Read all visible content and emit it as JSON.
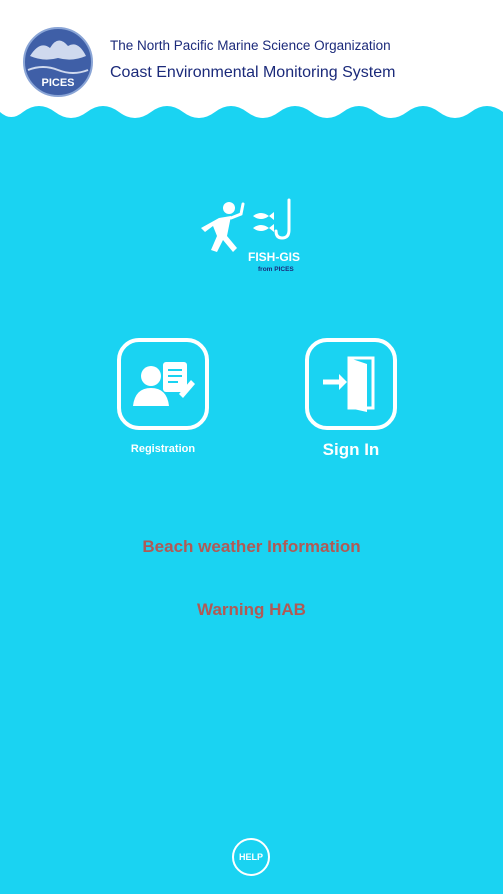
{
  "header": {
    "organization": "The North Pacific Marine Science Organization",
    "system": "Coast Environmental Monitoring System",
    "logo_text": "PICES"
  },
  "fish_gis": {
    "title": "FISH-GIS",
    "subtitle": "from PICES"
  },
  "actions": {
    "registration_label": "Registration",
    "sign_in_label": "Sign In"
  },
  "links": {
    "beach_weather": "Beach weather Information",
    "warning_hab": "Warning HAB"
  },
  "help_label": "HELP",
  "colors": {
    "background": "#1ad3f2",
    "header_text": "#1b2a7a",
    "link_text": "#b05a55",
    "white": "#ffffff"
  },
  "icons": [
    "pices-logo-icon",
    "fisherman-icon",
    "registration-icon",
    "sign-in-door-icon",
    "help-icon"
  ]
}
